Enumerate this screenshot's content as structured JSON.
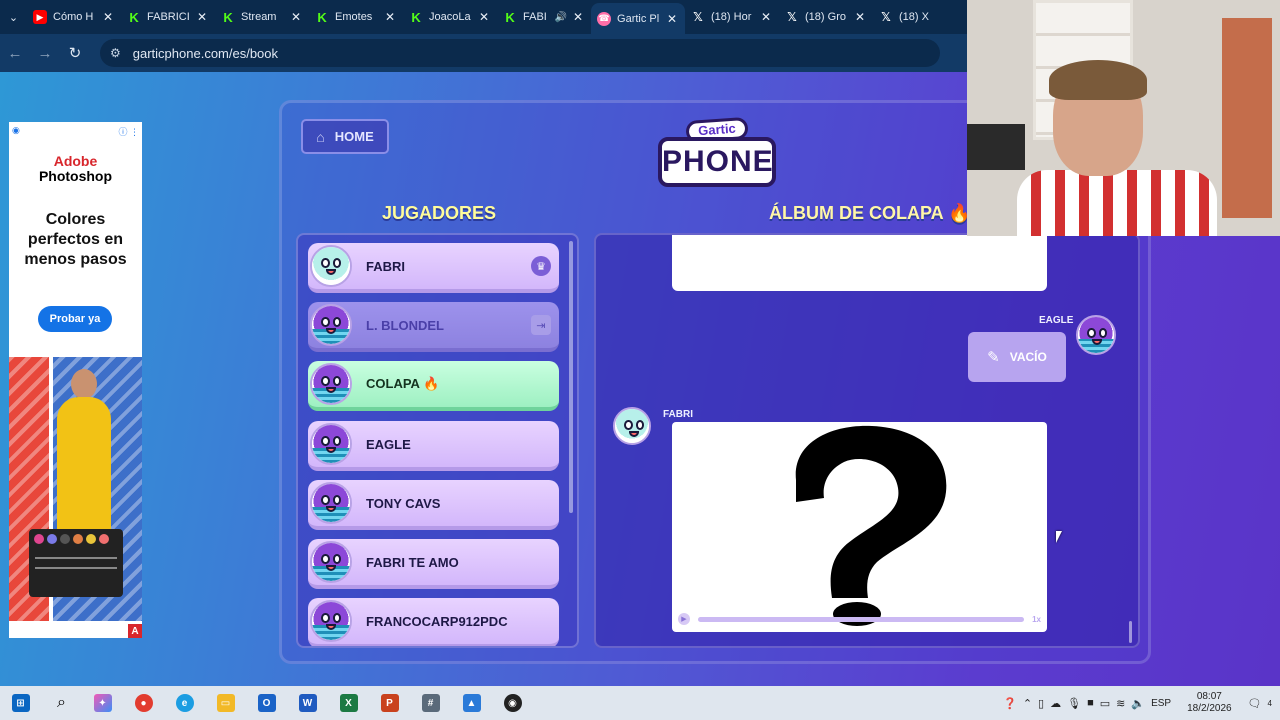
{
  "browser": {
    "tabs": [
      {
        "label": "Cómo H",
        "icon": "youtube-icon"
      },
      {
        "label": "FABRICI",
        "icon": "kick-icon"
      },
      {
        "label": "Stream",
        "icon": "kick-icon"
      },
      {
        "label": "Emotes",
        "icon": "kick-icon"
      },
      {
        "label": "JoacoLa",
        "icon": "kick-icon"
      },
      {
        "label": "FABI",
        "icon": "kick-icon"
      },
      {
        "label": "Gartic Pl",
        "icon": "gartic-icon",
        "active": true
      },
      {
        "label": "(18) Hor",
        "icon": "x-icon"
      },
      {
        "label": "(18) Gro",
        "icon": "x-icon"
      },
      {
        "label": "(18) X",
        "icon": "x-icon"
      }
    ],
    "url": "garticphone.com/es/book"
  },
  "ad": {
    "brand_line1": "Adobe",
    "brand_line2": "Photoshop",
    "headline": "Colores perfectos en menos pasos",
    "cta": "Probar ya"
  },
  "game": {
    "home_label": "HOME",
    "logo_top": "Gartic",
    "logo_bottom": "PHONE",
    "players_title": "JUGADORES",
    "album_title": "ÁLBUM DE COLAPA 🔥",
    "players": [
      {
        "name": "FABRI",
        "avatar": "teal",
        "badge": "crown-icon",
        "state": "normal"
      },
      {
        "name": "L. BLONDEL",
        "avatar": "purple",
        "badge": "exit-icon",
        "state": "gone"
      },
      {
        "name": "COLAPA 🔥",
        "avatar": "purple",
        "badge": "",
        "state": "active"
      },
      {
        "name": "EAGLE",
        "avatar": "purple",
        "badge": "",
        "state": "normal"
      },
      {
        "name": "TONY CAVS",
        "avatar": "purple",
        "badge": "",
        "state": "normal"
      },
      {
        "name": "FABRI TE AMO",
        "avatar": "purple",
        "badge": "",
        "state": "normal"
      },
      {
        "name": "FRANCOCARP912PDC",
        "avatar": "purple",
        "badge": "",
        "state": "normal"
      }
    ],
    "album": {
      "entry1_author": "EAGLE",
      "entry1_text": "VACÍO",
      "entry2_author": "FABRI",
      "playback_speed": "1x"
    }
  },
  "taskbar": {
    "language": "ESP",
    "time": "08:07",
    "date": "18/2/2026",
    "notifications": "4"
  },
  "colors": {
    "page_gradient_start": "#2e98d6",
    "page_gradient_end": "#5a34c8",
    "title_yellow": "#fff6a8",
    "active_player": "#9ef0c2"
  }
}
